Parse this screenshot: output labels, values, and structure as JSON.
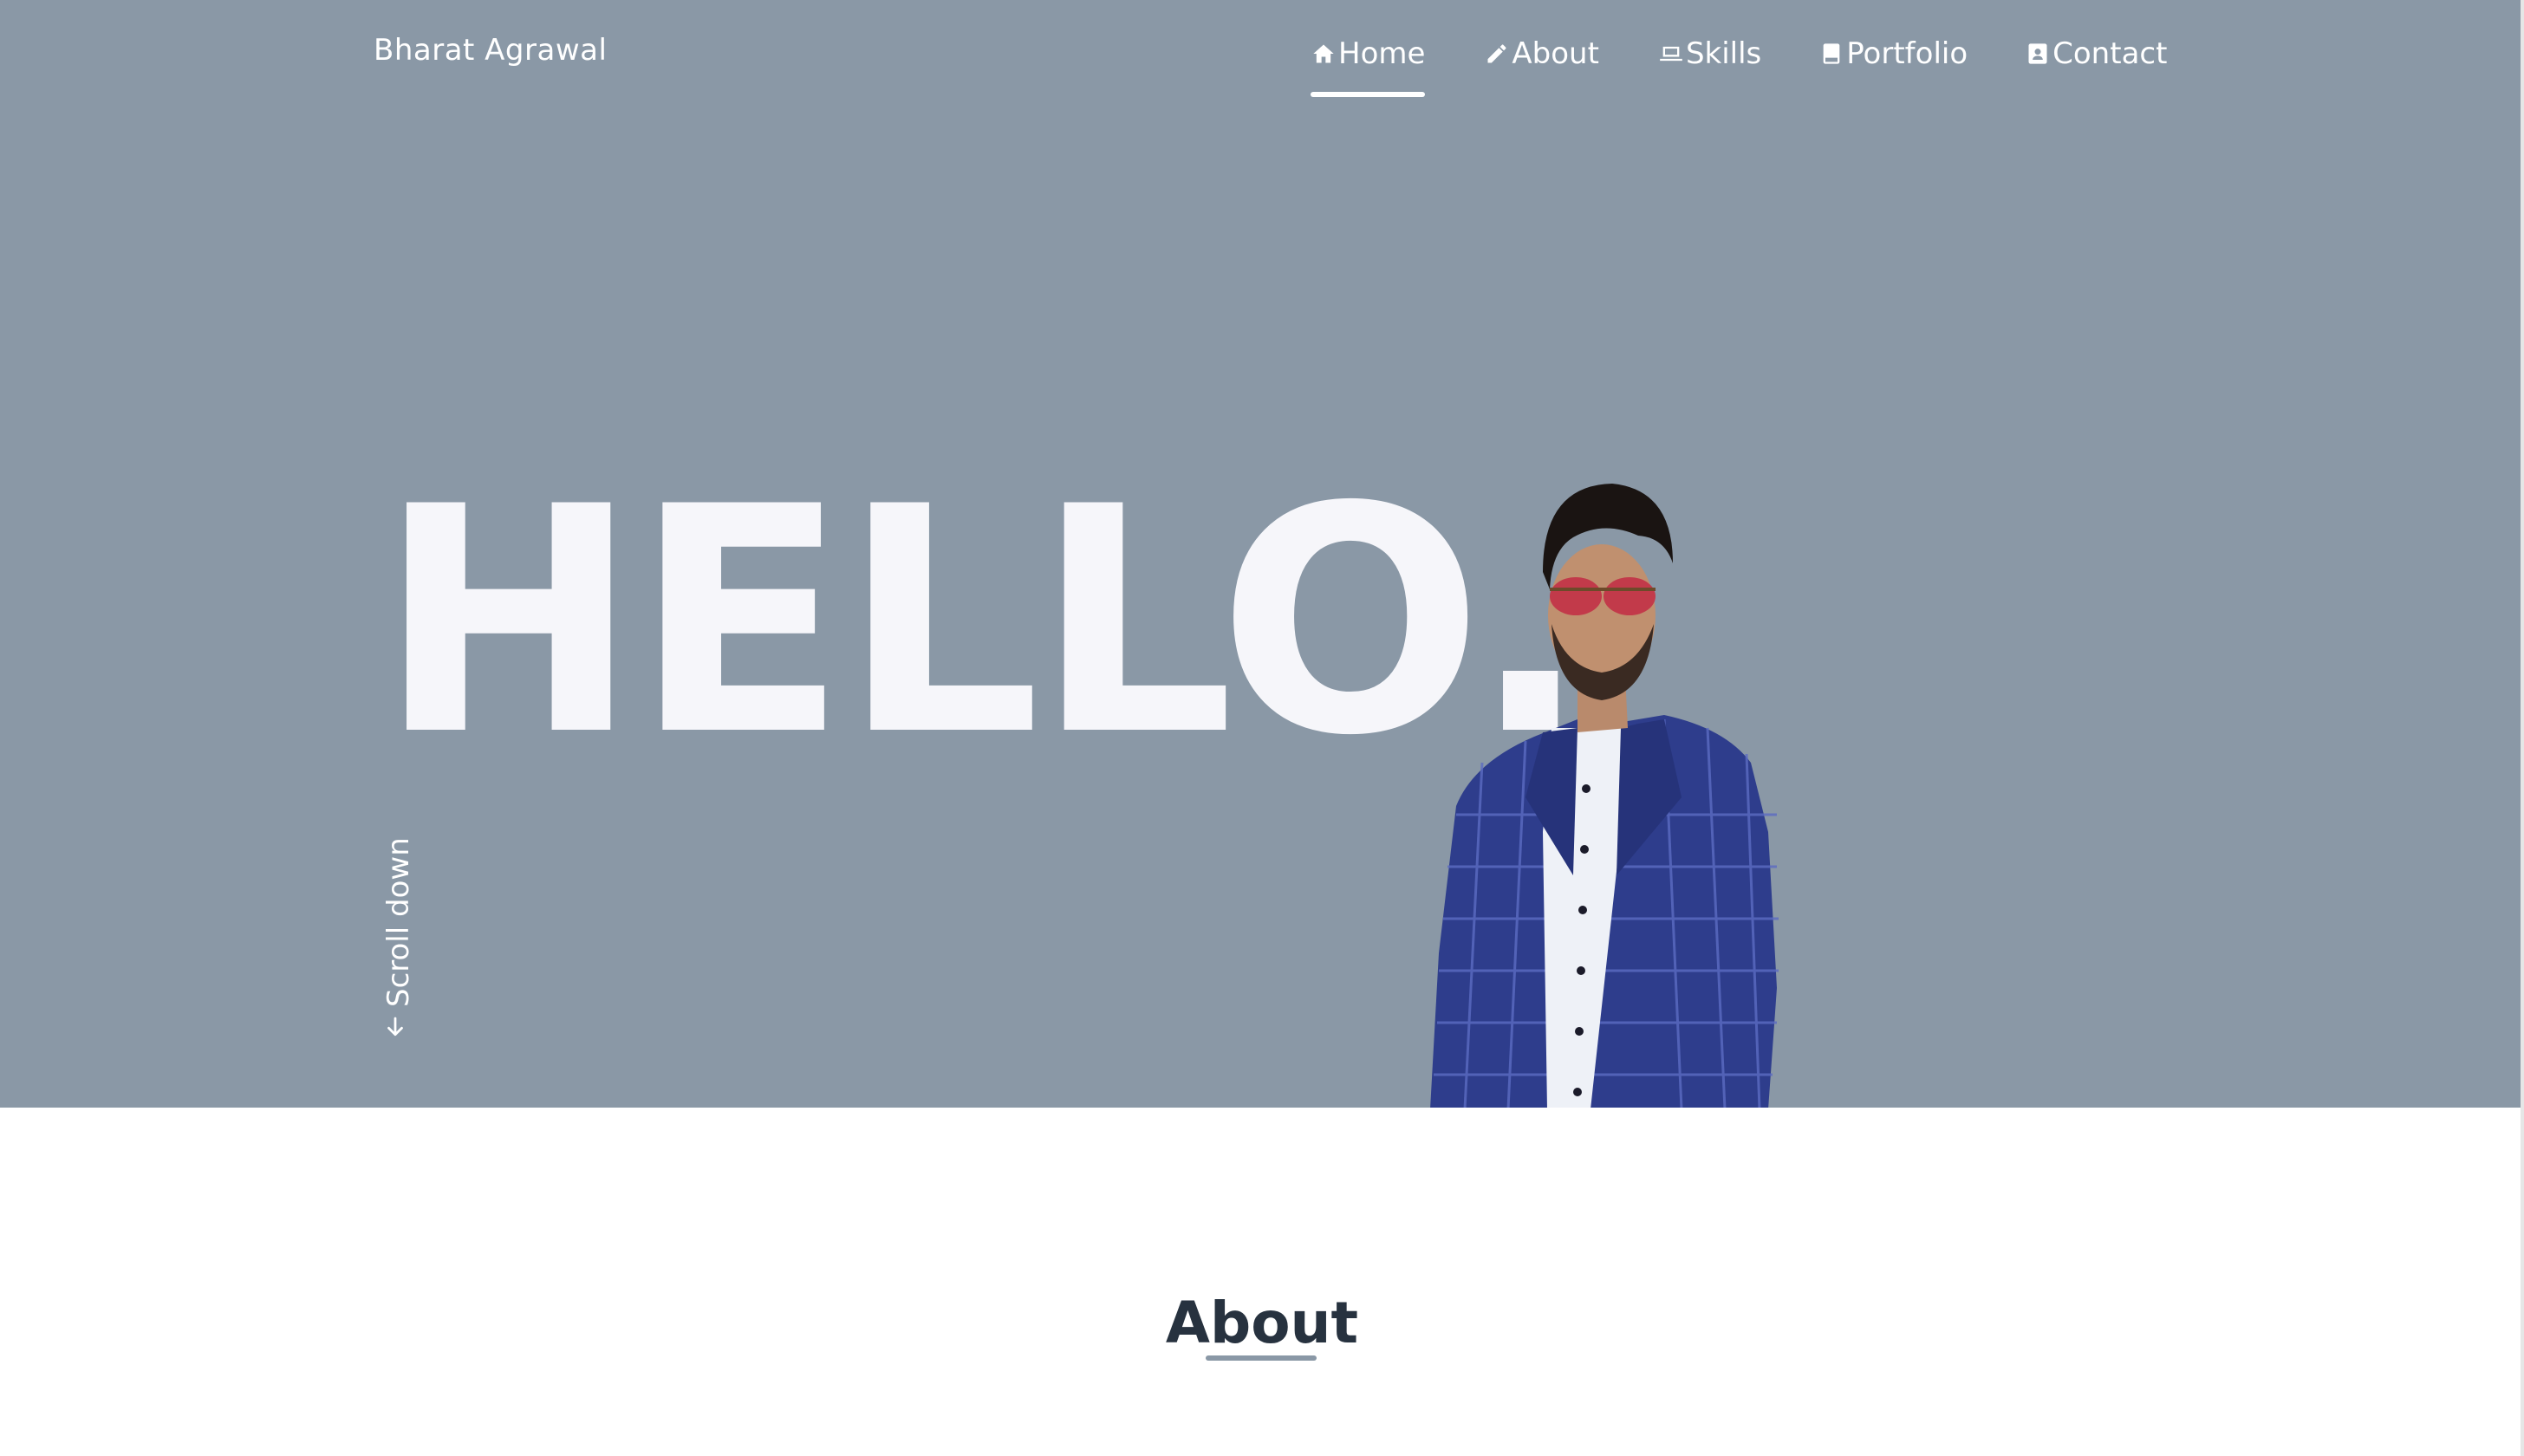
{
  "brand": {
    "name": "Bharat Agrawal"
  },
  "nav": {
    "items": [
      {
        "label": "Home",
        "icon": "home-icon",
        "active": true
      },
      {
        "label": "About",
        "icon": "pencil-icon",
        "active": false
      },
      {
        "label": "Skills",
        "icon": "laptop-icon",
        "active": false
      },
      {
        "label": "Portfolio",
        "icon": "book-icon",
        "active": false
      },
      {
        "label": "Contact",
        "icon": "contact-card-icon",
        "active": false
      }
    ]
  },
  "hero": {
    "headline": "HELLO.",
    "scroll_hint": "Scroll down",
    "scroll_icon": "arrow-down-icon",
    "background_color": "#8a98a6",
    "text_color": "#f6f6fa"
  },
  "about": {
    "title": "About",
    "title_color": "#27323f",
    "underline_color": "#8a98a6"
  }
}
